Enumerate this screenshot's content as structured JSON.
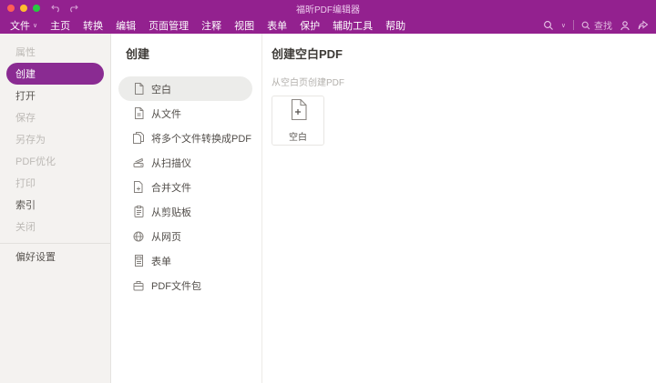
{
  "titlebar": {
    "title": "福昕PDF编辑器"
  },
  "menubar": {
    "items": [
      {
        "label": "文件"
      },
      {
        "label": "主页"
      },
      {
        "label": "转换"
      },
      {
        "label": "编辑"
      },
      {
        "label": "页面管理"
      },
      {
        "label": "注释"
      },
      {
        "label": "视图"
      },
      {
        "label": "表单"
      },
      {
        "label": "保护"
      },
      {
        "label": "辅助工具"
      },
      {
        "label": "帮助"
      }
    ],
    "search_label": "查找"
  },
  "sidebar": {
    "items": [
      {
        "label": "属性",
        "state": "disabled"
      },
      {
        "label": "创建",
        "state": "selected"
      },
      {
        "label": "打开",
        "state": "normal"
      },
      {
        "label": "保存",
        "state": "disabled"
      },
      {
        "label": "另存为",
        "state": "disabled"
      },
      {
        "label": "PDF优化",
        "state": "disabled"
      },
      {
        "label": "打印",
        "state": "disabled"
      },
      {
        "label": "索引",
        "state": "normal"
      },
      {
        "label": "关闭",
        "state": "disabled"
      }
    ],
    "footer_item": {
      "label": "偏好设置"
    }
  },
  "create_panel": {
    "title": "创建",
    "items": [
      {
        "label": "空白",
        "selected": true
      },
      {
        "label": "从文件"
      },
      {
        "label": "将多个文件转换成PDF"
      },
      {
        "label": "从扫描仪"
      },
      {
        "label": "合并文件"
      },
      {
        "label": "从剪贴板"
      },
      {
        "label": "从网页"
      },
      {
        "label": "表单"
      },
      {
        "label": "PDF文件包"
      }
    ]
  },
  "detail_panel": {
    "title": "创建空白PDF",
    "subtitle": "从空白页创建PDF",
    "card_label": "空白"
  },
  "colors": {
    "accent": "#93218f",
    "selected_pill": "#8a2b92",
    "list_selected_bg": "#ececea"
  }
}
